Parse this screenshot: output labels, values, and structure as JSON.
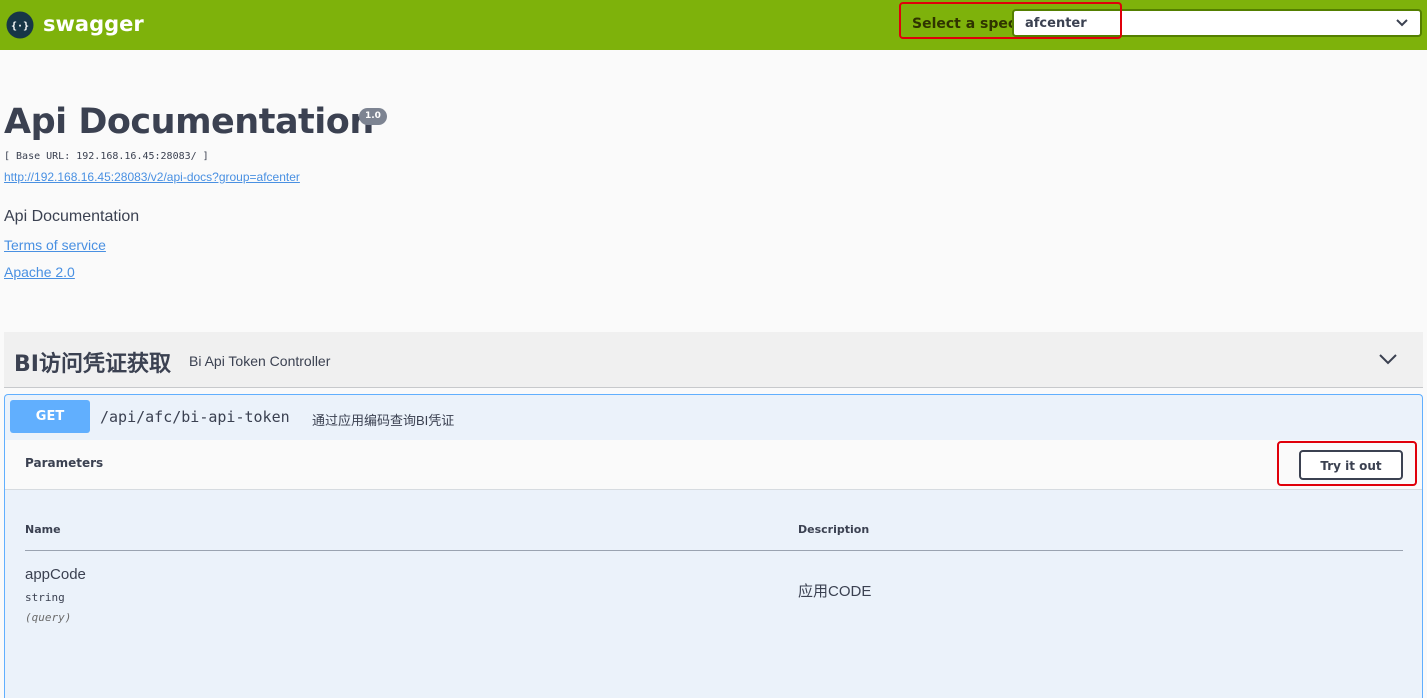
{
  "topbar": {
    "brand": "swagger",
    "logo_icon": "swagger-logo-icon",
    "spec_label": "Select a spec",
    "spec_value": "afcenter",
    "bg_color": "#7eb20b"
  },
  "info": {
    "title": "Api Documentation",
    "version": "1.0",
    "base_url": "[ Base URL: 192.168.16.45:28083/ ]",
    "docs_link": "http://192.168.16.45:28083/v2/api-docs?group=afcenter",
    "description": "Api Documentation",
    "terms": "Terms of service",
    "license": "Apache 2.0"
  },
  "tag": {
    "name": "BI访问凭证获取",
    "description": "Bi Api Token Controller",
    "toggle_icon": "chevron-down-icon"
  },
  "operation": {
    "method": "GET",
    "path": "/api/afc/bi-api-token",
    "summary": "通过应用编码查询BI凭证",
    "parameters_title": "Parameters",
    "try_it_out": "Try it out",
    "columns": {
      "name": "Name",
      "description": "Description"
    },
    "params": [
      {
        "name": "appCode",
        "type": "string",
        "in": "(query)",
        "description": "应用CODE"
      }
    ],
    "method_color": "#61affe"
  },
  "highlight_color": "#e0000a"
}
